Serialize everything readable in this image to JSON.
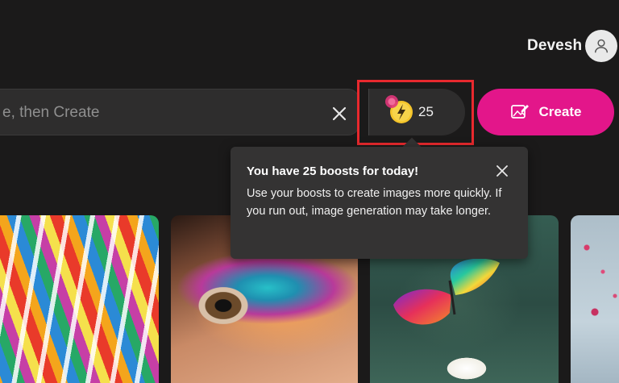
{
  "header": {
    "user_name": "Devesh"
  },
  "search": {
    "placeholder": "e, then Create",
    "value": ""
  },
  "boosts": {
    "count": "25",
    "icon": "lightning-bolt-icon"
  },
  "create_button": {
    "label": "Create",
    "icon": "image-edit-icon"
  },
  "tooltip": {
    "title": "You have 25 boosts for today!",
    "body": "Use your boosts to create images more quickly. If you run out, image generation may take longer."
  },
  "colors": {
    "background": "#1b1a1a",
    "accent": "#e3168a",
    "highlight": "#e8292e",
    "boost_coin": "#f5c52a"
  }
}
